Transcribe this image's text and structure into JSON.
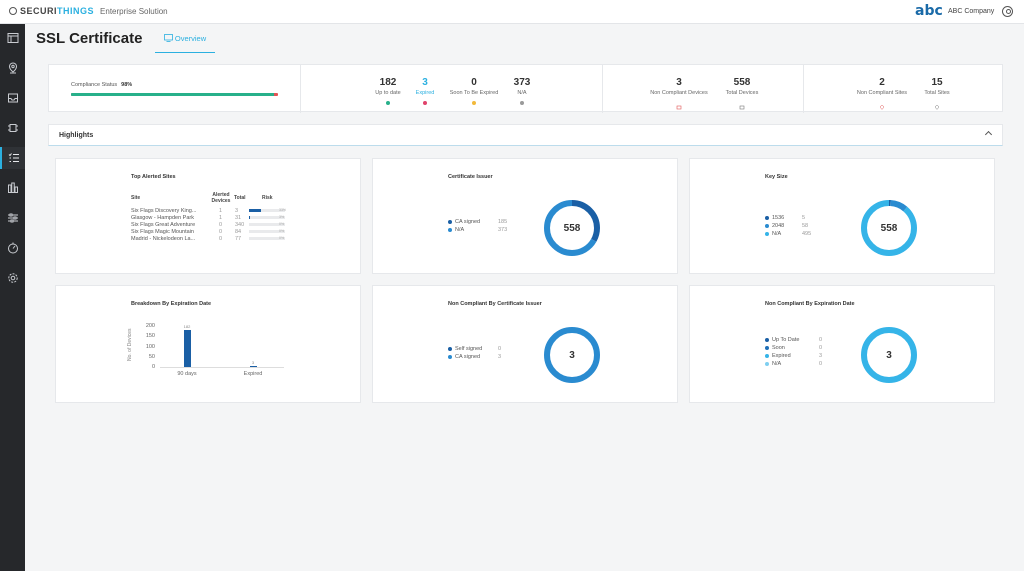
{
  "header": {
    "brand_left": "SECURI",
    "brand_right": "THINGS",
    "brand_sub": "Enterprise Solution",
    "company_logo": "abc",
    "company_name": "ABC Company"
  },
  "sidebar": {
    "items": [
      {
        "icon": "layout-icon"
      },
      {
        "icon": "map-pin-icon"
      },
      {
        "icon": "inbox-icon"
      },
      {
        "icon": "camera-icon"
      },
      {
        "icon": "list-check-icon",
        "active": true
      },
      {
        "icon": "bar-chart-icon"
      },
      {
        "icon": "sliders-icon"
      },
      {
        "icon": "gauge-icon"
      },
      {
        "icon": "settings-icon"
      }
    ]
  },
  "page": {
    "title": "SSL Certificate",
    "tab_overview": "Overview"
  },
  "stats": {
    "compliance_label": "Compliance Status",
    "compliance_value": "98%",
    "compliance_fraction": 0.98,
    "up_to_date": {
      "value": "182",
      "label": "Up to date",
      "color": "#27b08a"
    },
    "expired": {
      "value": "3",
      "label": "Expired",
      "color": "#e0436b"
    },
    "soon_expired": {
      "value": "0",
      "label": "Soon To Be Expired",
      "color": "#f2b93b"
    },
    "na": {
      "value": "373",
      "label": "N/A",
      "color": "#9a9a9a"
    },
    "non_compliant_devices": {
      "value": "3",
      "label": "Non Compliant Devices"
    },
    "total_devices": {
      "value": "558",
      "label": "Total Devices"
    },
    "non_compliant_sites": {
      "value": "2",
      "label": "Non Compliant Sites"
    },
    "total_sites": {
      "value": "15",
      "label": "Total Sites"
    }
  },
  "highlights": {
    "title": "Highlights"
  },
  "top_alerted": {
    "title": "Top Alerted Sites",
    "col_site": "Site",
    "col_alerted": "Alerted Devices",
    "col_total": "Total",
    "col_risk": "Risk",
    "rows": [
      {
        "site": "Six Flags Discovery King...",
        "alerted": "1",
        "total": "3",
        "risk": 0.33,
        "risk_label": "33%"
      },
      {
        "site": "Glasgow - Hampden Park",
        "alerted": "1",
        "total": "31",
        "risk": 0.03,
        "risk_label": "3%"
      },
      {
        "site": "Six Flags Great Adventure",
        "alerted": "0",
        "total": "340",
        "risk": 0,
        "risk_label": "0%"
      },
      {
        "site": "Six Flags Magic Mountain",
        "alerted": "0",
        "total": "84",
        "risk": 0,
        "risk_label": "0%"
      },
      {
        "site": "Madrid - Nickelodeon La...",
        "alerted": "0",
        "total": "77",
        "risk": 0,
        "risk_label": "0%"
      }
    ]
  },
  "cert_issuer": {
    "title": "Certificate Issuer",
    "total": "558",
    "items": [
      {
        "label": "CA signed",
        "value": "185",
        "color": "#1a5fa5"
      },
      {
        "label": "N/A",
        "value": "373",
        "color": "#2a8bd0"
      }
    ]
  },
  "key_size": {
    "title": "Key Size",
    "total": "558",
    "items": [
      {
        "label": "1536",
        "value": "5",
        "color": "#1a5fa5"
      },
      {
        "label": "2048",
        "value": "58",
        "color": "#2a8bd0"
      },
      {
        "label": "N/A",
        "value": "495",
        "color": "#35b4e8"
      }
    ]
  },
  "breakdown": {
    "title": "Breakdown By Expiration Date",
    "y_title": "No. of Devices",
    "y_ticks": [
      "200",
      "150",
      "100",
      "50",
      "0"
    ]
  },
  "nc_issuer": {
    "title": "Non Compliant By Certificate Issuer",
    "total": "3",
    "items": [
      {
        "label": "Self signed",
        "value": "0",
        "color": "#1a5fa5"
      },
      {
        "label": "CA signed",
        "value": "3",
        "color": "#2a8bd0"
      }
    ]
  },
  "nc_expiration": {
    "title": "Non Compliant By Expiration Date",
    "total": "3",
    "items": [
      {
        "label": "Up To Date",
        "value": "0",
        "color": "#1a5fa5"
      },
      {
        "label": "Soon",
        "value": "0",
        "color": "#1f6fb8"
      },
      {
        "label": "Expired",
        "value": "3",
        "color": "#35b4e8"
      },
      {
        "label": "N/A",
        "value": "0",
        "color": "#7fcff0"
      }
    ]
  },
  "chart_data": [
    {
      "type": "bar",
      "title": "Breakdown By Expiration Date",
      "categories": [
        "90 days",
        "Expired"
      ],
      "values": [
        182,
        3
      ],
      "value_labels": [
        "182",
        "3"
      ],
      "ylabel": "No. of Devices",
      "ylim": [
        0,
        200
      ],
      "grid": false
    },
    {
      "type": "pie",
      "title": "Certificate Issuer",
      "categories": [
        "CA signed",
        "N/A"
      ],
      "values": [
        185,
        373
      ],
      "center_label": "558"
    },
    {
      "type": "pie",
      "title": "Key Size",
      "categories": [
        "1536",
        "2048",
        "N/A"
      ],
      "values": [
        5,
        58,
        495
      ],
      "center_label": "558"
    },
    {
      "type": "pie",
      "title": "Non Compliant By Certificate Issuer",
      "categories": [
        "Self signed",
        "CA signed"
      ],
      "values": [
        0,
        3
      ],
      "center_label": "3"
    },
    {
      "type": "pie",
      "title": "Non Compliant By Expiration Date",
      "categories": [
        "Up To Date",
        "Soon",
        "Expired",
        "N/A"
      ],
      "values": [
        0,
        0,
        3,
        0
      ],
      "center_label": "3"
    }
  ]
}
